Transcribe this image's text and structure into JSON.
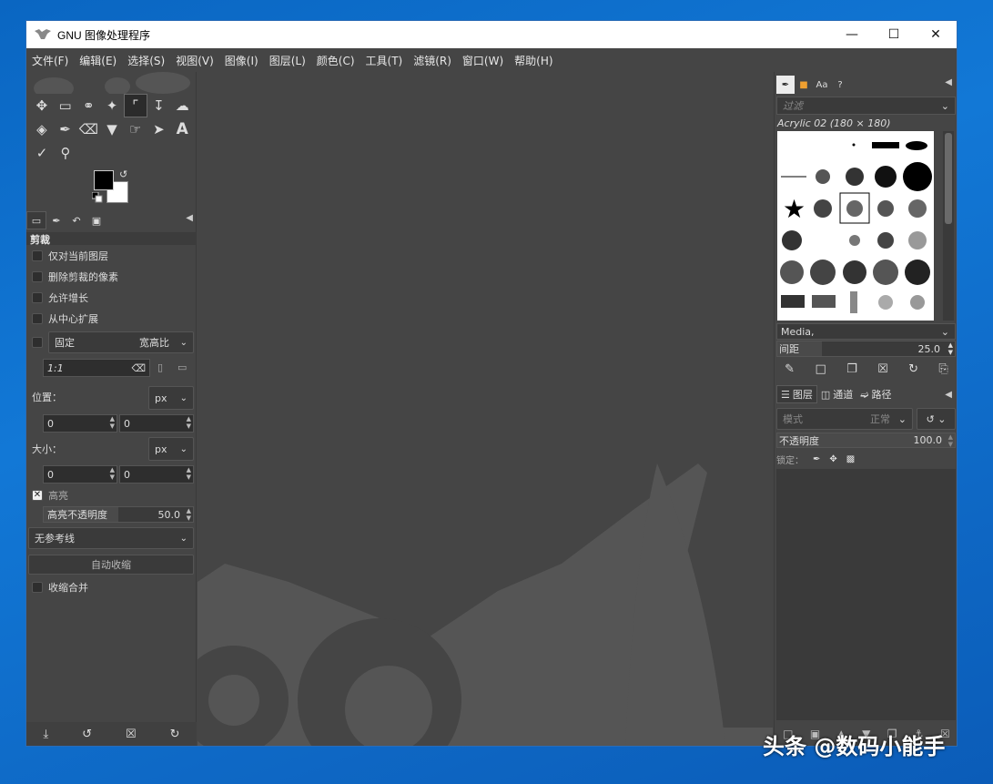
{
  "window": {
    "title": "GNU 图像处理程序"
  },
  "menu": [
    "文件(F)",
    "编辑(E)",
    "选择(S)",
    "视图(V)",
    "图像(I)",
    "图层(L)",
    "颜色(C)",
    "工具(T)",
    "滤镜(R)",
    "窗口(W)",
    "帮助(H)"
  ],
  "tools": {
    "row1": [
      "move-tool",
      "rect-select-tool",
      "lasso-tool",
      "fuzzy-select-tool",
      "crop-tool",
      "transform-tool",
      "warp-tool"
    ],
    "row2": [
      "bucket-fill-tool",
      "paintbrush-tool",
      "eraser-tool",
      "clone-tool",
      "smudge-tool",
      "paths-tool",
      "text-tool"
    ],
    "row3": [
      "color-picker-tool",
      "zoom-tool"
    ],
    "text_glyph": "A"
  },
  "tool_options": {
    "title": "剪裁",
    "current_layer_only": "仅对当前图层",
    "delete_cropped": "删除剪裁的像素",
    "allow_growing": "允许增长",
    "expand_from_center": "从中心扩展",
    "fixed_label": "固定",
    "fixed_value": "宽高比",
    "ratio": "1:1",
    "position_label": "位置：",
    "position_unit": "px",
    "position_x": "0",
    "position_y": "0",
    "size_label": "大小：",
    "size_unit": "px",
    "size_w": "0",
    "size_h": "0",
    "highlight_label": "高亮",
    "highlight_opacity_label": "高亮不透明度",
    "highlight_opacity_value": "50.0",
    "guides_value": "无参考线",
    "auto_shrink_label": "自动收缩",
    "shrink_merged_label": "收缩合并"
  },
  "brushes": {
    "filter_placeholder": "过滤",
    "selected_brush": "Acrylic 02 (180 × 180)",
    "tag": "Media,",
    "spacing_label": "间距",
    "spacing_value": "25.0"
  },
  "layers": {
    "tabs": [
      "图层",
      "通道",
      "路径"
    ],
    "mode_label": "模式",
    "mode_value": "正常",
    "opacity_label": "不透明度",
    "opacity_value": "100.0",
    "lock_label": "锁定："
  },
  "watermark": "头条 @数码小能手",
  "colors": {
    "background": "#454545",
    "panel": "#3a3a3a",
    "wilber": "#555555"
  }
}
